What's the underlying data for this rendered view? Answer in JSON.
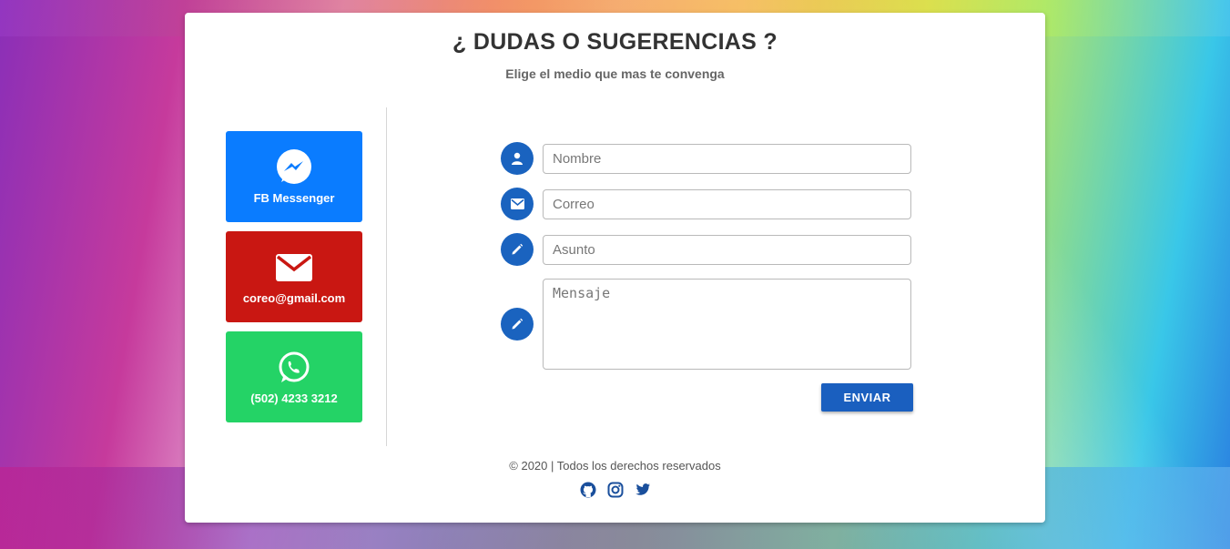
{
  "header": {
    "title": "¿ DUDAS O SUGERENCIAS ?",
    "subtitle": "Elige el medio que mas te convenga"
  },
  "contacts": [
    {
      "label": "FB Messenger",
      "icon": "messenger-icon",
      "color": "#0a7cff"
    },
    {
      "label": "coreo@gmail.com",
      "icon": "envelope-icon",
      "color": "#c91712"
    },
    {
      "label": "(502) 4233 3212",
      "icon": "whatsapp-icon",
      "color": "#24d366"
    }
  ],
  "form": {
    "name_placeholder": "Nombre",
    "email_placeholder": "Correo",
    "subject_placeholder": "Asunto",
    "message_placeholder": "Mensaje",
    "submit_label": "ENVIAR",
    "accent": "#1a63bf"
  },
  "footer": {
    "copyright": "© 2020 | Todos los derechos reservados",
    "social": [
      "github-icon",
      "instagram-icon",
      "twitter-icon"
    ],
    "social_color": "#1a4f9c"
  }
}
